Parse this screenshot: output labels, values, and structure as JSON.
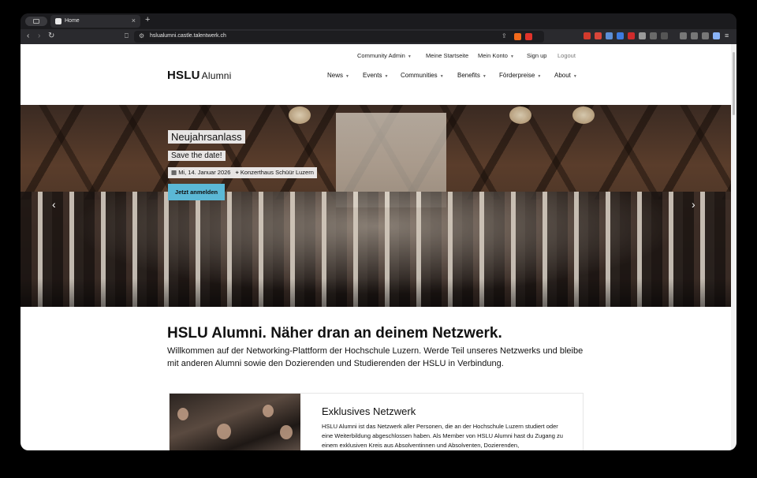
{
  "browser": {
    "tab_title": "Home",
    "tab_close": "×",
    "new_tab": "+",
    "url": "hslualumni.castle.talentwerk.ch",
    "nav": {
      "back": "‹",
      "forward": "›",
      "reload": "↻"
    }
  },
  "site": {
    "logo_main": "HSLU",
    "logo_sub": "Alumni",
    "utility_nav": [
      "Community Admin",
      "Meine Startseite",
      "Mein Konto",
      "Sign up",
      "Logout"
    ],
    "main_nav": [
      "News",
      "Events",
      "Communities",
      "Benefits",
      "Förderpreise",
      "About"
    ]
  },
  "hero": {
    "title": "Neujahrsanlass",
    "subtitle": "Save the date!",
    "date": "Mi, 14. Januar 2026",
    "location": "Konzerthaus Schüür Luzern",
    "button": "Jetzt anmelden",
    "prev": "‹",
    "next": "›"
  },
  "intro": {
    "headline": "HSLU Alumni. Näher dran an deinem Netzwerk.",
    "text": "Willkommen auf der Networking-Plattform der Hochschule Luzern. Werde Teil unseres Netzwerks und bleibe mit anderen Alumni sowie den Dozierenden und Studierenden der HSLU in Verbindung."
  },
  "card": {
    "title": "Exklusives Netzwerk",
    "text": "HSLU Alumni ist das Netzwerk aller Personen, die an der Hochschule Luzern studiert oder eine Weiterbildung abgeschlossen haben. Als Member von HSLU Alumni hast du Zugang zu einem exklusiven Kreis aus Absolventinnen und Absolventen, Dozierenden,"
  },
  "colors": {
    "button": "#5bb8d6",
    "chrome": "#2a2a2e"
  }
}
